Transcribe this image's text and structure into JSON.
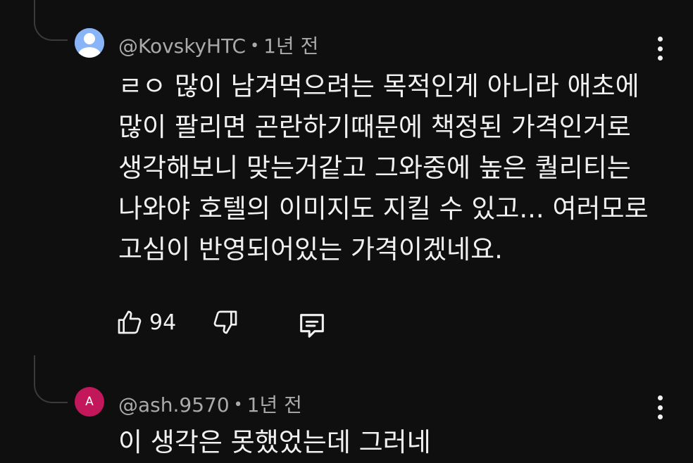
{
  "comments": [
    {
      "author": "@KovskyHTC",
      "separator": "•",
      "time": "1년 전",
      "lines": [
        "ㄹㅇ 많이 남겨먹으려는 목적인게 아니라 애초에",
        "많이 팔리면 곤란하기때문에 책정된 가격인거로",
        "생각해보니 맞는거같고 그와중에 높은 퀄리티는",
        "나와야 호텔의 이미지도 지킬 수 있고... 여러모로",
        "고심이 반영되어있는 가격이겠네요."
      ],
      "likes": "94"
    },
    {
      "author": "@ash.9570",
      "separator": "•",
      "time": "1년 전",
      "avatar_letter": "A",
      "preview_line": "이 생각은 못했었는데 그러네"
    }
  ],
  "icons": {
    "avatar1": "default-user-avatar-icon",
    "like": "thumbs-up-icon",
    "dislike": "thumbs-down-icon",
    "reply": "comment-reply-icon",
    "menu": "more-vertical-icon"
  },
  "colors": {
    "background": "#0f0f0f",
    "text": "#f1f1f1",
    "secondary_text": "#aaaaaa",
    "avatar1": "#8ab4f8",
    "avatar2": "#c2185b"
  }
}
